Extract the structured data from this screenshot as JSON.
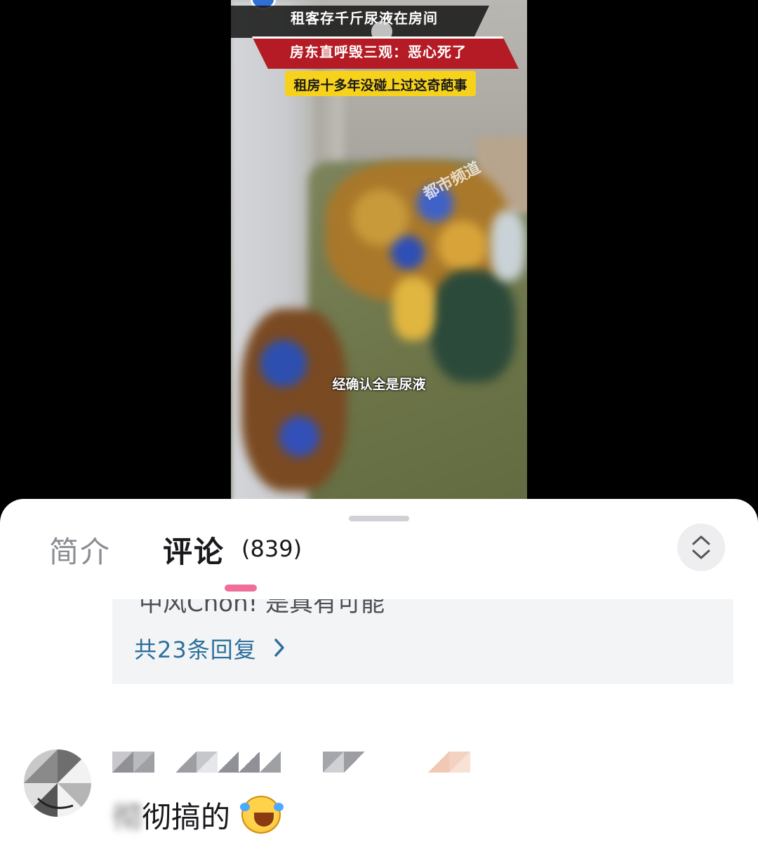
{
  "video": {
    "banner_line1": "租客存千斤尿液在房间",
    "banner_line2": "房东直呼毁三观：恶心死了",
    "banner_line3": "租房十多年没碰上过这奇葩事",
    "channel_watermark": "都市频道",
    "subtitle": "经确认全是尿液"
  },
  "tabs": {
    "intro_label": "简介",
    "comments_label": "评论",
    "comments_count": "(839)"
  },
  "reply_box": {
    "clipped_text": "中风Choh! 是真有可能",
    "reply_link": "共23条回复"
  },
  "comment": {
    "blurred_prefix": "彻",
    "text": "彻搞的"
  },
  "icons": {
    "expand": "chevron-up-down-icon",
    "reply_arrow": "chevron-right-icon",
    "emoji": "laughing-crying-emoji-icon"
  },
  "colors": {
    "accent_pink": "#f06f99",
    "link_blue": "#2c6f9c",
    "banner_red": "#b51b24",
    "banner_yellow": "#f7d21b"
  }
}
